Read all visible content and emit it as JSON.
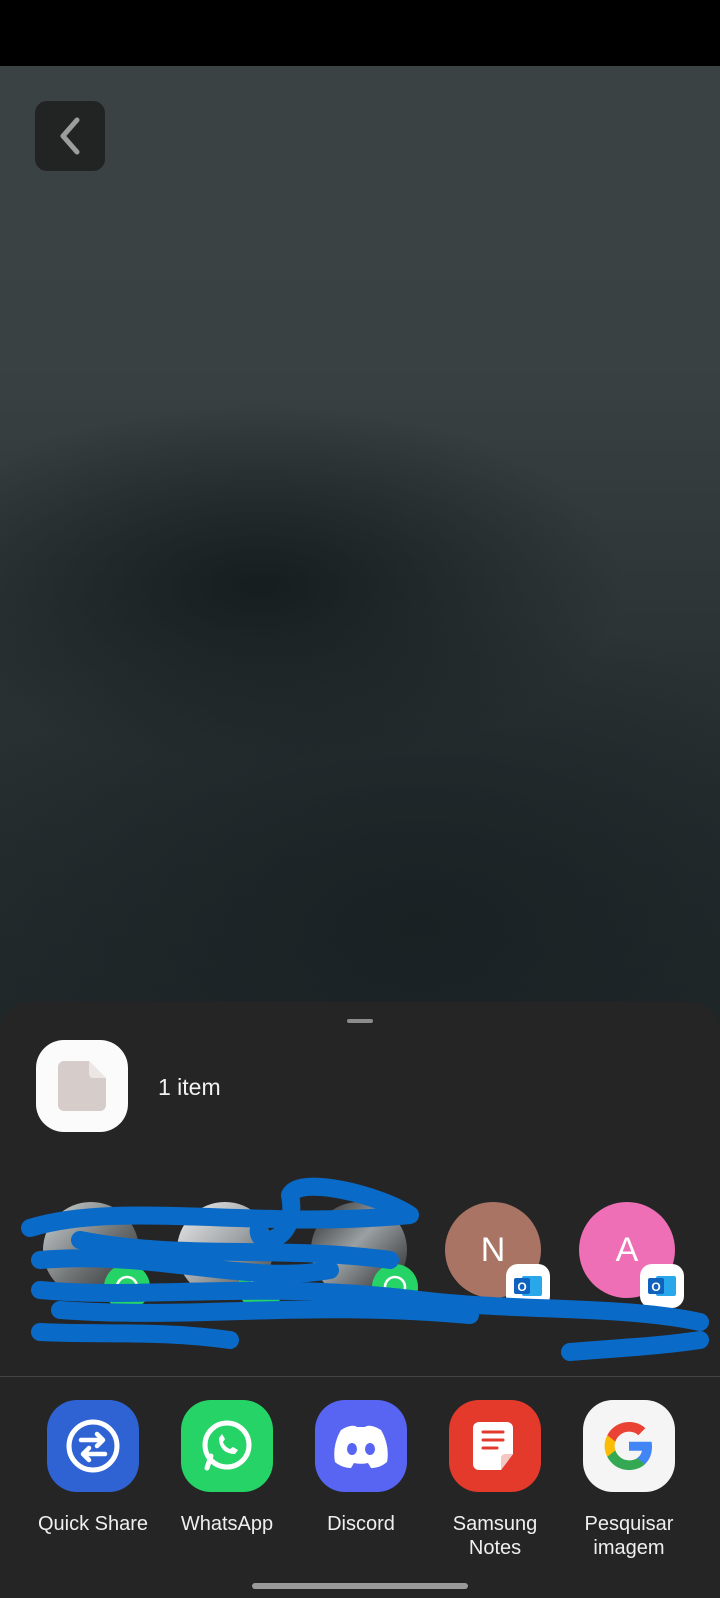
{
  "share_sheet": {
    "item_count": "1 item",
    "contacts": [
      {
        "type": "photo",
        "name": "",
        "badge": "whatsapp-icon"
      },
      {
        "type": "photo",
        "name": "",
        "badge": "whatsapp-icon"
      },
      {
        "type": "photo",
        "name": "",
        "badge": "whatsapp-icon"
      },
      {
        "type": "letter",
        "initial": "N",
        "name": "",
        "badge": "outlook-icon",
        "color": "#a97463"
      },
      {
        "type": "letter",
        "initial": "A",
        "name": "",
        "badge": "outlook-icon",
        "color": "#ee6fb5"
      }
    ],
    "apps": [
      {
        "label": "Quick Share",
        "icon": "quick-share-icon",
        "color": "#2f63d4"
      },
      {
        "label": "WhatsApp",
        "icon": "whatsapp-icon",
        "color": "#25d366"
      },
      {
        "label": "Discord",
        "icon": "discord-icon",
        "color": "#5865f2"
      },
      {
        "label": "Samsung Notes",
        "icon": "samsung-notes-icon",
        "color": "#e33a2c"
      },
      {
        "label": "Pesquisar imagem",
        "icon": "google-icon",
        "color": "#f5f5f5"
      }
    ]
  }
}
